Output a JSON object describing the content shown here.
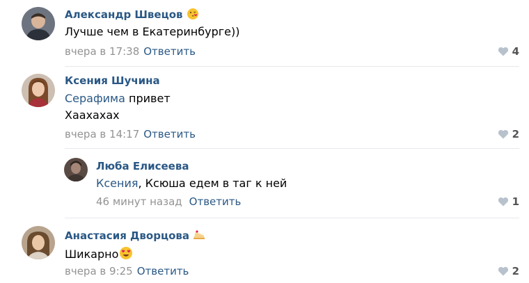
{
  "comments": [
    {
      "author": "Александр Швецов",
      "author_emoji_icon": "kissing-face-icon",
      "text_lines": [
        "Лучше чем в Екатеринбурге))"
      ],
      "timestamp": "вчера в 17:38",
      "reply_label": "Ответить",
      "likes": "4"
    },
    {
      "author": "Ксения Шучина",
      "mention": "Серафима",
      "text_after_mention": " привет",
      "text_lines": [
        "Хаахахах"
      ],
      "timestamp": "вчера в 14:17",
      "reply_label": "Ответить",
      "likes": "2"
    },
    {
      "author": "Люба Елисеева",
      "mention": "Ксения",
      "text_after_mention": ", Ксюша едем в таг к ней",
      "timestamp": "46 минут назад",
      "reply_label": "Ответить",
      "likes": "1"
    },
    {
      "author": "Анастасия Дворцова",
      "author_emoji_icon": "cake-icon",
      "text": "Шикарно",
      "text_emoji_icon": "heart-eyes-face-icon",
      "timestamp": "вчера в 9:25",
      "reply_label": "Ответить",
      "likes": "2"
    }
  ],
  "colors": {
    "link": "#2a5885",
    "meta": "#939393",
    "divider": "#e7e8ec",
    "like_icon": "#b8c2cc"
  }
}
